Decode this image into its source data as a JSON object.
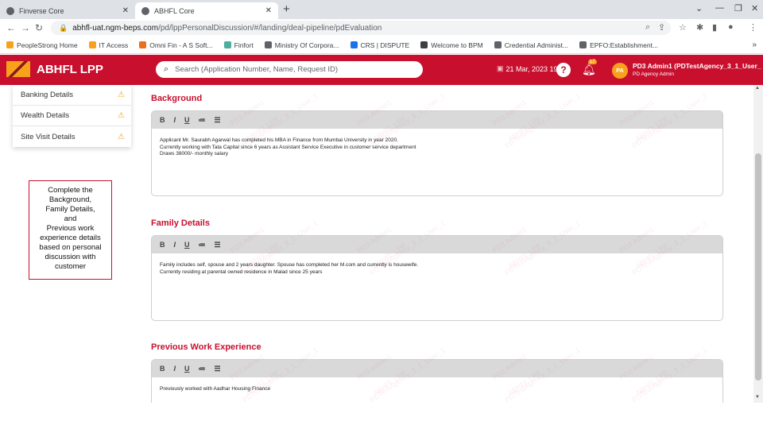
{
  "browser": {
    "tabs": [
      {
        "title": "Finverse Core",
        "active": false
      },
      {
        "title": "ABHFL Core",
        "active": true
      }
    ],
    "url_host": "abhfl-uat.ngm-beps.com",
    "url_path": "/pd/lppPersonalDiscussion/#/landing/deal-pipeline/pdEvaluation",
    "bookmarks": [
      {
        "label": "PeopleStrong Home",
        "color": "#f7a21b"
      },
      {
        "label": "IT Access",
        "color": "#f7a21b"
      },
      {
        "label": "Omni Fin - A S Soft...",
        "color": "#e8711c"
      },
      {
        "label": "Finfort",
        "color": "#4caf9e"
      },
      {
        "label": "Ministry Of Corpora...",
        "color": "#5f6368"
      },
      {
        "label": "CRS | DISPUTE",
        "color": "#1a73e8"
      },
      {
        "label": "Welcome to BPM",
        "color": "#3c4043"
      },
      {
        "label": "Credential Administ...",
        "color": "#5f6368"
      },
      {
        "label": "EPFO:Establishment...",
        "color": "#5f6368"
      }
    ]
  },
  "app": {
    "logo_text": "ABHFL LPP",
    "search_placeholder": "Search (Application Number, Name, Request ID)",
    "datetime": "21 Mar, 2023 19:46",
    "notification_count": "17",
    "avatar_initials": "PA",
    "user_name": "PD3 Admin1 (PDTestAgency_3_1_User_",
    "user_role": "PD Agency Admin",
    "brand_color": "#c8102e"
  },
  "sidebar": {
    "items": [
      {
        "label": "Banking Details"
      },
      {
        "label": "Wealth Details"
      },
      {
        "label": "Site Visit Details"
      }
    ]
  },
  "note": "Complete the\nBackground,\nFamily Details,\nand\nPrevious work\nexperience details\nbased on personal\ndiscussion with\ncustomer",
  "toolbar": {
    "bold": "B",
    "italic": "I",
    "underline": "U",
    "ol": "≔",
    "ul": "☰"
  },
  "sections": {
    "background": {
      "title": "Background",
      "lines": [
        "Applicant Mr. Saurabh Agarwal has completed his MBA in Finance from Mumbai University in year 2020.",
        "Currently working with Tata Capital since 6 years as Assistant Service Executive in customer service department",
        "Draws 38000/- monthly salary"
      ]
    },
    "family": {
      "title": "Family Details",
      "lines": [
        "Family includes self, spouse and 2 years daughter. Spouse has completed her M.com and currently is housewife.",
        "Currently residing at parental owned residence in Malad since 25 years"
      ]
    },
    "work": {
      "title": "Previous Work Experience",
      "lines": [
        "Previously worked with Aadhar Housing Finance"
      ]
    }
  },
  "watermark": [
    "PD3 Admin1",
    "PDTestAgency_3_1_User_1",
    "ABHFL LPP"
  ]
}
